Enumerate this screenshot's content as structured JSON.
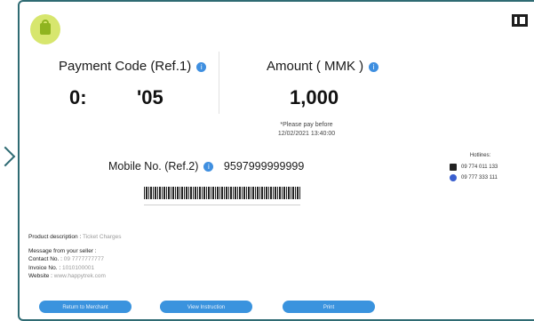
{
  "header": {
    "logo_text": "",
    "brand_caption": ""
  },
  "payment_code": {
    "label": "Payment Code (Ref.1)",
    "value_part1": "0:",
    "value_part2": "'05"
  },
  "amount": {
    "label": "Amount ( MMK )",
    "value": "1,000"
  },
  "pay_note": {
    "line1": "*Please pay before",
    "line2": "12/02/2021 13:40:00"
  },
  "mobile": {
    "label": "Mobile No. (Ref.2)",
    "value": "9597999999999"
  },
  "hotlines": {
    "title": "Hotlines:",
    "items": [
      {
        "icon": "phone-icon",
        "number": "09 774 011 133"
      },
      {
        "icon": "viber-icon",
        "number": "09 777 333 111"
      }
    ]
  },
  "barcode_caption": "",
  "details": {
    "product_label": "Product description :",
    "product_value": "Ticket Charges",
    "message_label": "Message from your seller :",
    "contact_label": "Contact No. :",
    "contact_value": "09 7777777777",
    "invoice_label": "Invoice No. :",
    "invoice_value": "1010100001",
    "website_label": "Website :",
    "website_value": "www.happytrek.com"
  },
  "buttons": {
    "return": "Return to Merchant",
    "instructions": "View Instruction",
    "print": "Print"
  },
  "colors": {
    "accent": "#3a93de",
    "frame": "#2f6b73"
  }
}
